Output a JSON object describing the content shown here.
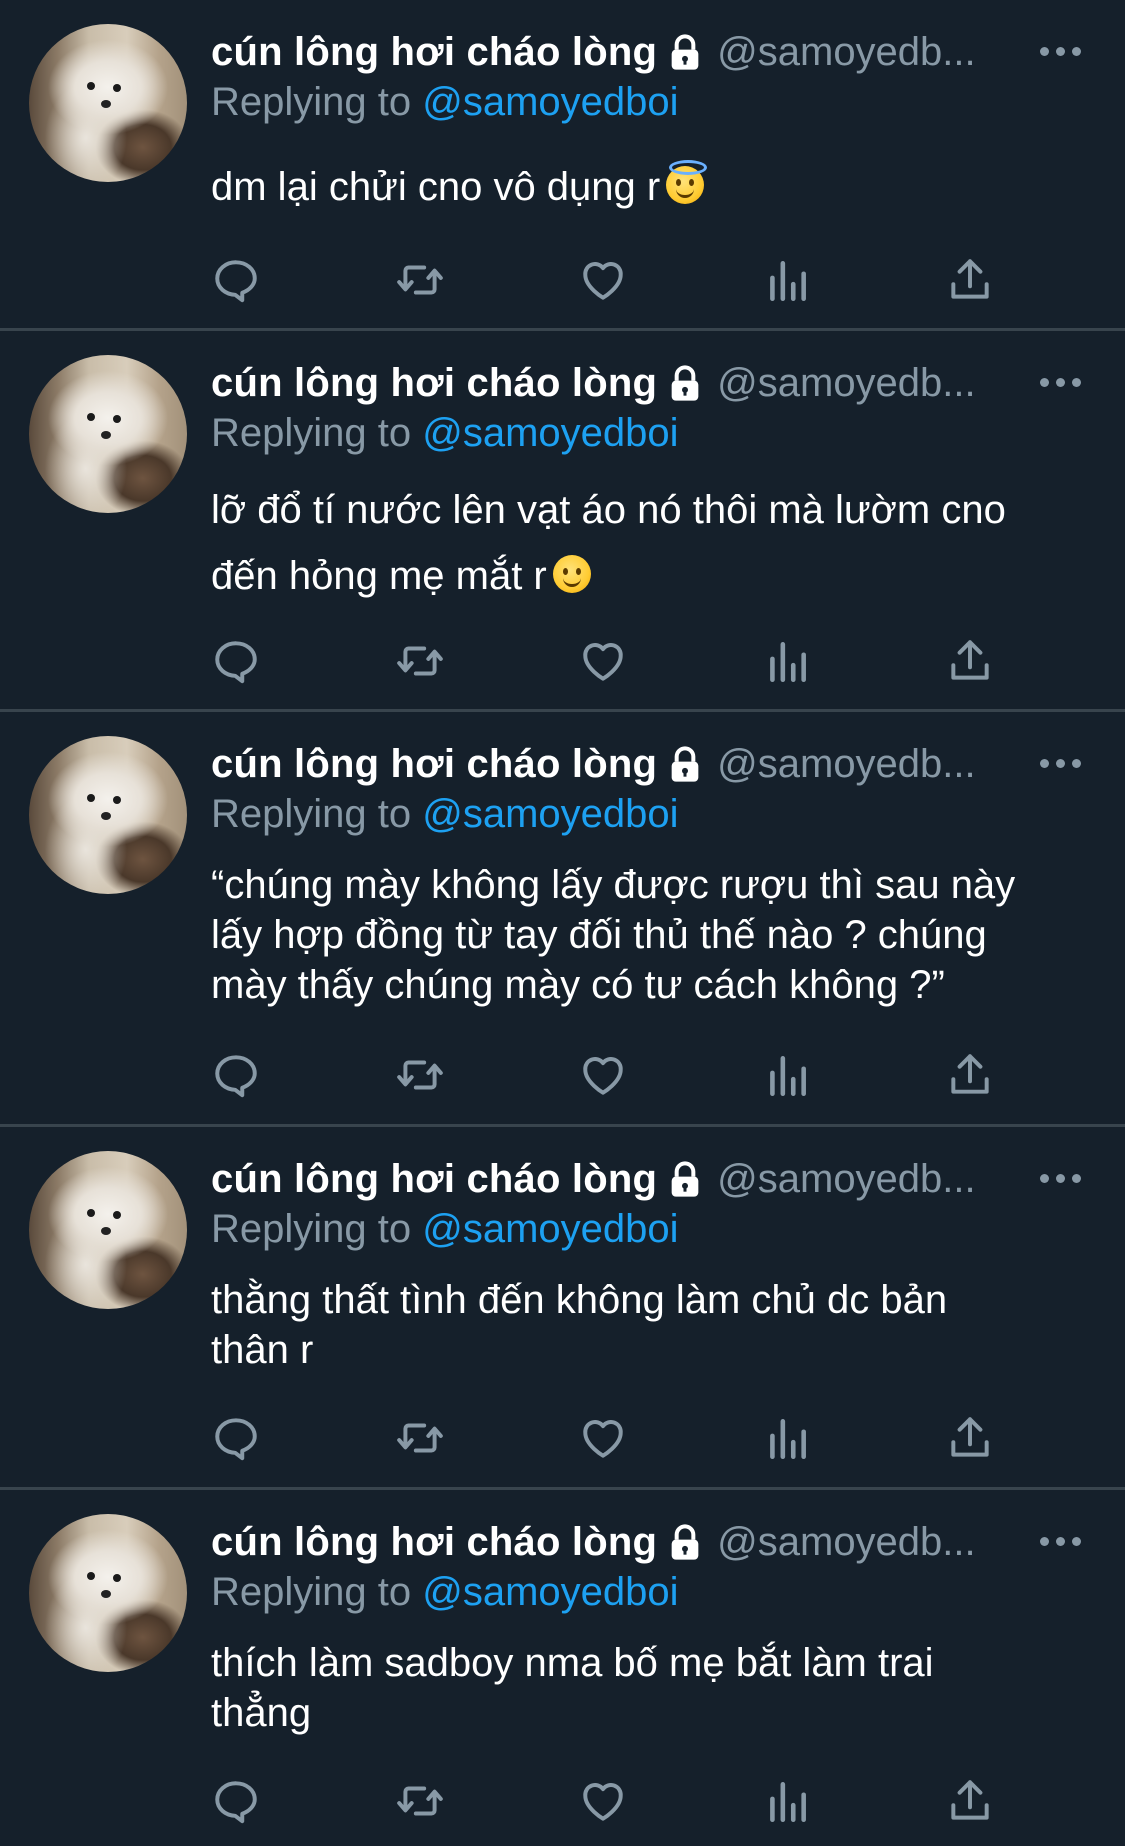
{
  "tweets": [
    {
      "name": "cún lông hơi cháo lòng",
      "handle": "@samoyedb...",
      "replying_prefix": "Replying to",
      "replying_to": "@samoyedboi",
      "lines": [
        "dm lại chửi cno vô dụng r"
      ],
      "emoji": "smiling-face-with-halo"
    },
    {
      "name": "cún lông hơi cháo lòng",
      "handle": "@samoyedb...",
      "replying_prefix": "Replying to",
      "replying_to": "@samoyedboi",
      "lines": [
        "lỡ đổ tí nước lên vạt áo nó thôi mà lườm cno",
        "đến hỏng mẹ mắt r"
      ],
      "emoji": "slightly-smiling-face"
    },
    {
      "name": "cún lông hơi cháo lòng",
      "handle": "@samoyedb...",
      "replying_prefix": "Replying to",
      "replying_to": "@samoyedboi",
      "lines": [
        "“chúng mày không lấy được rượu thì sau này",
        "lấy hợp đồng từ tay đối thủ thế nào ? chúng",
        "mày thấy chúng mày có tư cách không ?”"
      ]
    },
    {
      "name": "cún lông hơi cháo lòng",
      "handle": "@samoyedb...",
      "replying_prefix": "Replying to",
      "replying_to": "@samoyedboi",
      "lines": [
        "thằng thất tình đến không làm chủ dc bản",
        "thân r"
      ]
    },
    {
      "name": "cún lông hơi cháo lòng",
      "handle": "@samoyedb...",
      "replying_prefix": "Replying to",
      "replying_to": "@samoyedboi",
      "lines": [
        "thích làm sadboy nma bố mẹ bắt làm trai",
        "thẳng"
      ]
    }
  ],
  "icons": {
    "reply": "reply-icon",
    "retweet": "retweet-icon",
    "like": "heart-icon",
    "analytics": "analytics-icon",
    "share": "share-icon",
    "more": "more-dots-icon",
    "protected": "lock-icon"
  },
  "colors": {
    "background": "#15202b",
    "divider": "#38444d",
    "secondary_text": "#8899a6",
    "mention": "#1da1f2",
    "primary_text": "#ffffff"
  }
}
